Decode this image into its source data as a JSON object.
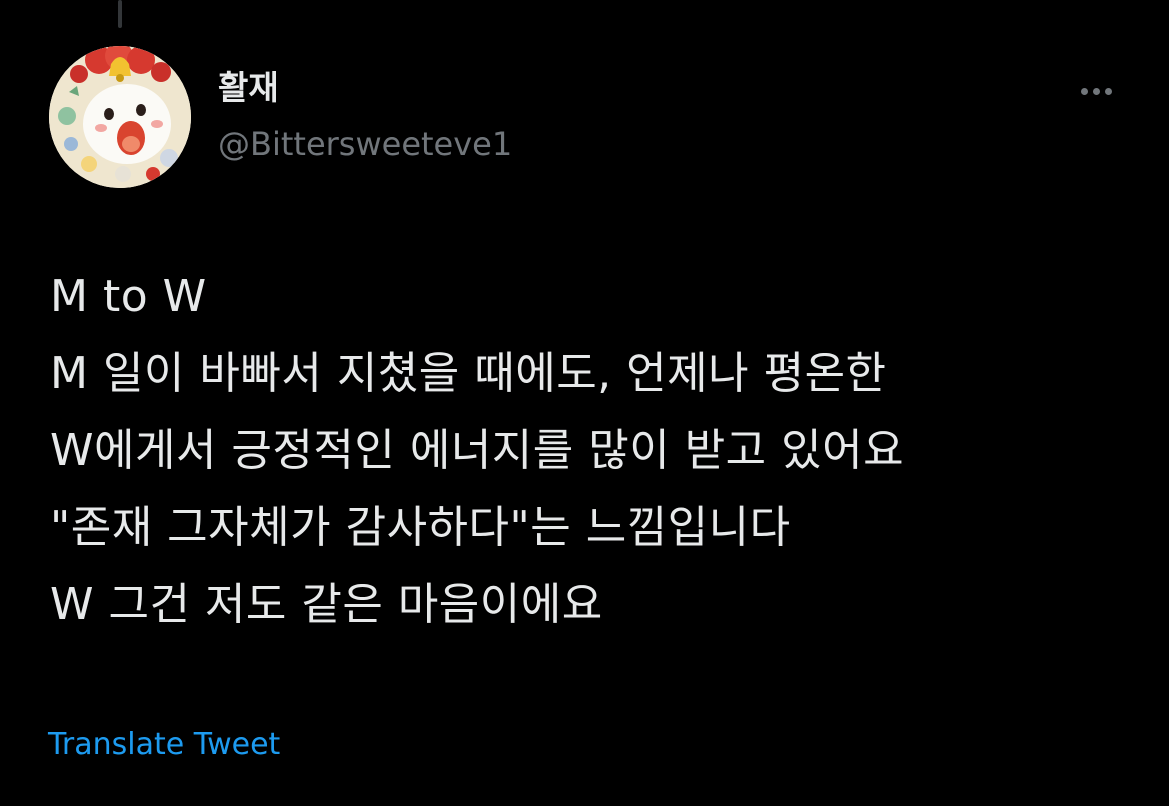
{
  "tweet": {
    "author": {
      "display_name": "활재",
      "handle": "@Bittersweeteve1",
      "avatar_icon": "avatar-illustration-icon"
    },
    "more_icon": "more-horizontal-icon",
    "text_lines": [
      "M to W",
      "M 일이 바빠서 지쳤을 때에도, 언제나 평온한",
      "W에게서 긍정적인 에너지를 많이 받고 있어요",
      "\"존재 그자체가 감사하다\"는 느낌입니다",
      "W 그건 저도 같은 마음이에요"
    ],
    "translate_label": "Translate Tweet"
  },
  "colors": {
    "background": "#000000",
    "primary_text": "#e7e9ea",
    "secondary_text": "#71767b",
    "accent": "#1d9bf0"
  }
}
